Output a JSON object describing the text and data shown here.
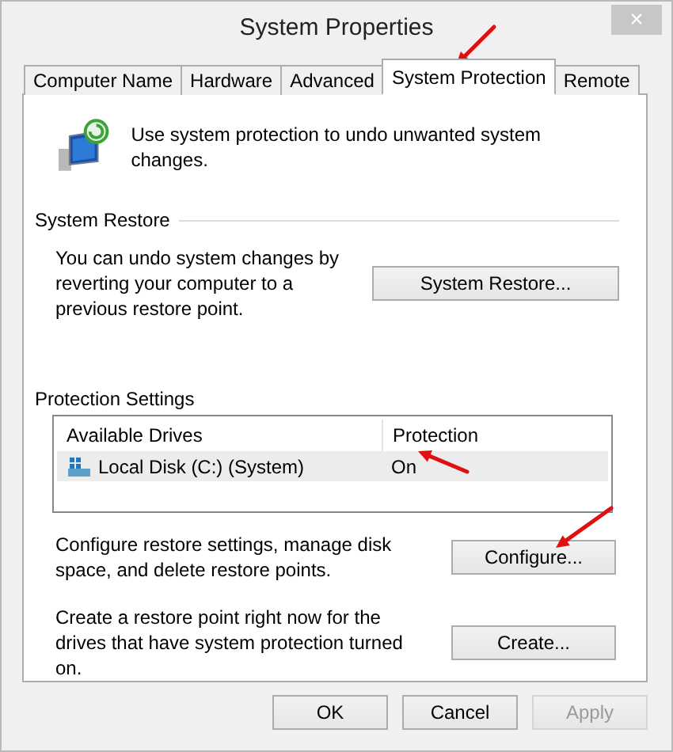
{
  "window": {
    "title": "System Properties",
    "close": "×"
  },
  "tabs": [
    {
      "label": "Computer Name",
      "selected": false
    },
    {
      "label": "Hardware",
      "selected": false
    },
    {
      "label": "Advanced",
      "selected": false
    },
    {
      "label": "System Protection",
      "selected": true
    },
    {
      "label": "Remote",
      "selected": false
    }
  ],
  "intro": "Use system protection to undo unwanted system changes.",
  "system_restore": {
    "heading": "System Restore",
    "description": "You can undo system changes by reverting your computer to a previous restore point.",
    "button": "System Restore..."
  },
  "protection_settings": {
    "heading": "Protection Settings",
    "columns": [
      "Available Drives",
      "Protection"
    ],
    "rows": [
      {
        "drive": "Local Disk (C:) (System)",
        "protection": "On",
        "selected": true
      }
    ],
    "actions": [
      {
        "description": "Configure restore settings, manage disk space, and delete restore points.",
        "button": "Configure..."
      },
      {
        "description": "Create a restore point right now for the drives that have system protection turned on.",
        "button": "Create..."
      }
    ]
  },
  "buttons": [
    {
      "label": "OK",
      "disabled": false
    },
    {
      "label": "Cancel",
      "disabled": false
    },
    {
      "label": "Apply",
      "disabled": true
    }
  ]
}
